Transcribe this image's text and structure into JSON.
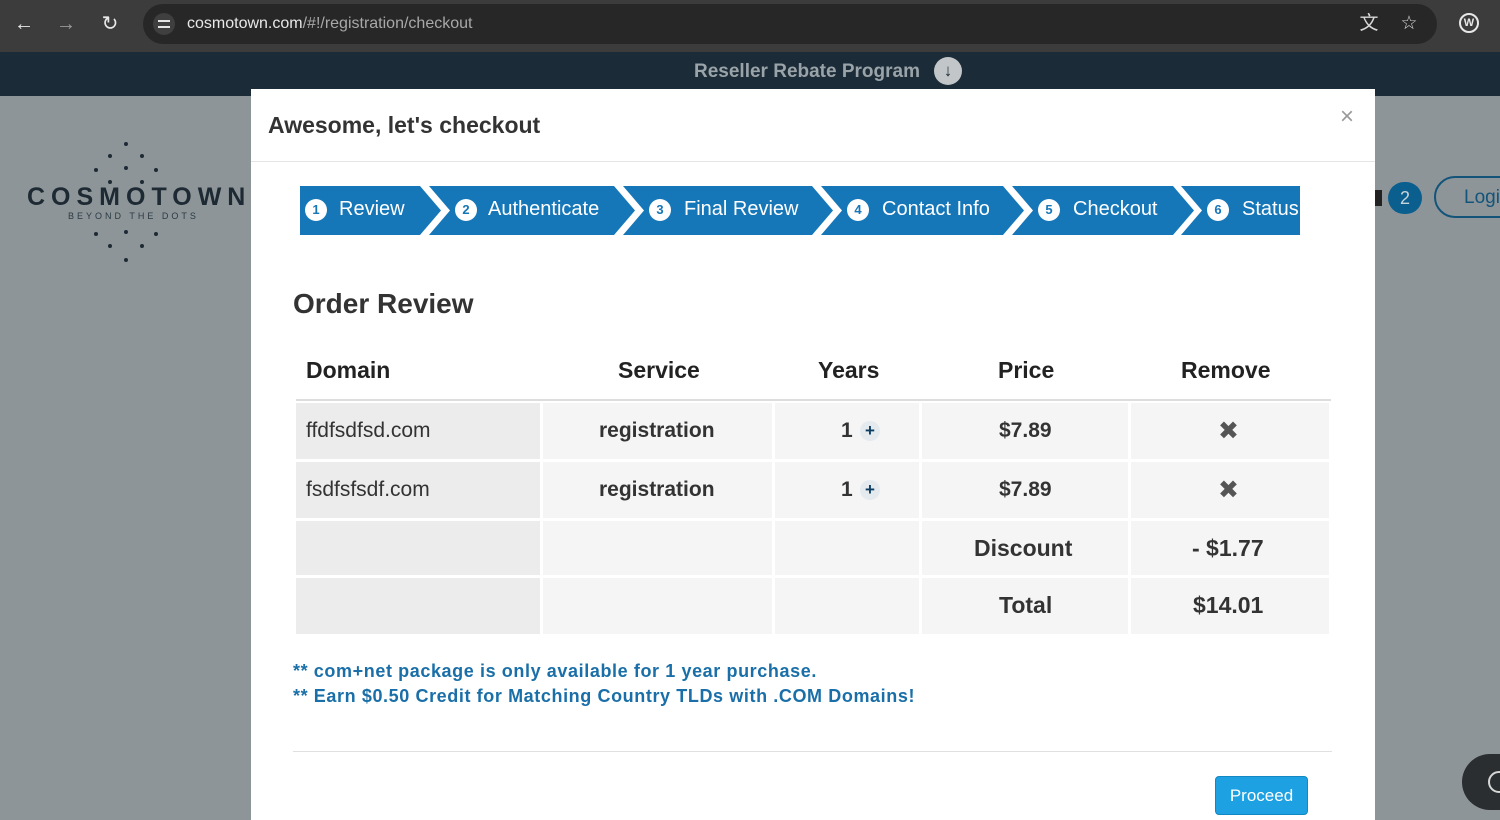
{
  "browser": {
    "url_host": "cosmotown.com",
    "url_path": "/#!/registration/checkout",
    "back_icon": "arrow-left-icon",
    "forward_icon": "arrow-right-icon",
    "reload_icon": "reload-icon",
    "profile_initial": "W"
  },
  "site": {
    "banner_text": "Reseller Rebate Program",
    "logo_text": "COSMOTOWN",
    "logo_subtext": "BEYOND THE DOTS",
    "cart_count": "2",
    "login_label": "Logi"
  },
  "modal": {
    "title": "Awesome, let's checkout",
    "close_label": "×"
  },
  "steps": [
    {
      "number": "1",
      "label": "Review"
    },
    {
      "number": "2",
      "label": "Authenticate"
    },
    {
      "number": "3",
      "label": "Final Review"
    },
    {
      "number": "4",
      "label": "Contact Info"
    },
    {
      "number": "5",
      "label": "Checkout"
    },
    {
      "number": "6",
      "label": "Status"
    }
  ],
  "order": {
    "title": "Order Review",
    "columns": [
      "Domain",
      "Service",
      "Years",
      "Price",
      "Remove"
    ],
    "rows": [
      {
        "domain": "ffdfsdfsd.com",
        "service": "registration",
        "years": "1",
        "price": "$7.89"
      },
      {
        "domain": "fsdfsfsdf.com",
        "service": "registration",
        "years": "1",
        "price": "$7.89"
      }
    ],
    "discount_label": "Discount",
    "discount_value": "- $1.77",
    "total_label": "Total",
    "total_value": "$14.01"
  },
  "notes": [
    "** com+net package is only available for 1 year purchase.",
    "** Earn $0.50 Credit for Matching Country TLDs with .COM Domains!"
  ],
  "proceed_label": "Proceed",
  "colors": {
    "step_blue": "#1576b8",
    "note_blue": "#1a6fa8",
    "proceed_blue": "#1da1e2"
  }
}
